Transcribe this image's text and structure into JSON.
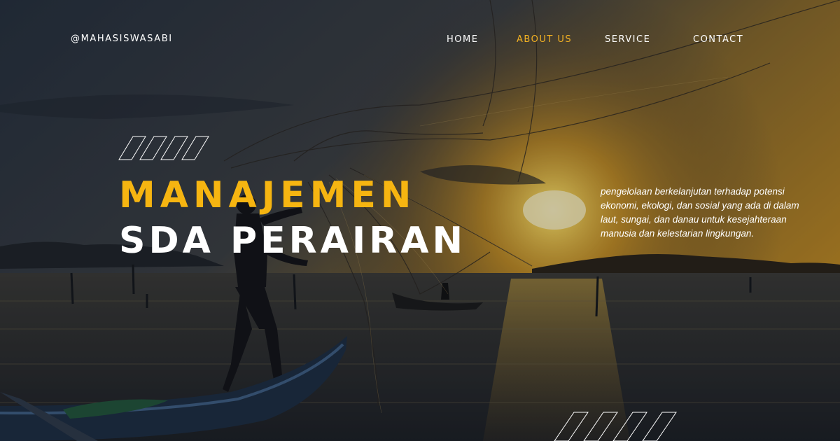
{
  "brand": {
    "handle": "@MAHASISWASABI"
  },
  "nav": {
    "items": [
      {
        "label": "HOME",
        "active": false
      },
      {
        "label": "ABOUT US",
        "active": true
      },
      {
        "label": "SERVICE",
        "active": false
      },
      {
        "label": "CONTACT",
        "active": false
      }
    ]
  },
  "hero": {
    "title_line1": "MANAJEMEN",
    "title_line2": "SDA PERAIRAN",
    "description": "pengelolaan berkelanjutan terhadap potensi ekonomi, ekologi, dan sosial yang ada di dalam laut, sungai, dan danau untuk kesejahteraan manusia dan kelestarian lingkungan."
  },
  "colors": {
    "accent": "#f6b511",
    "text": "#ffffff",
    "sky_dark": "#27313f",
    "sun": "#f7c531",
    "water": "#2a2b2c"
  }
}
